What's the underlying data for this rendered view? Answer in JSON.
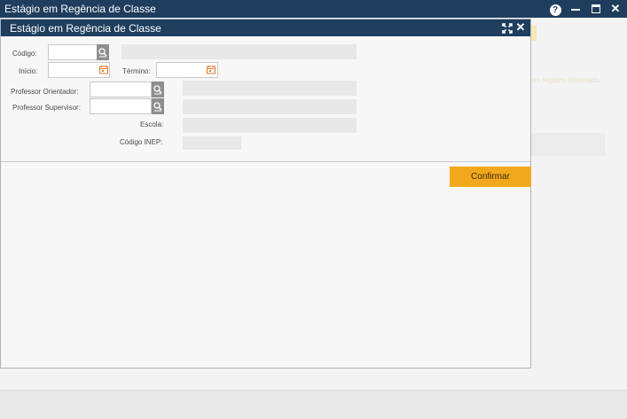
{
  "app": {
    "title": "Estágio em Regência de Classe",
    "help_label": "?",
    "close_label": "✕"
  },
  "background": {
    "hint_text": "um registro informado"
  },
  "dialog": {
    "title": "Estágio em Regência de Classe",
    "close_label": "✕",
    "fields": {
      "codigo_label": "Código:",
      "inicio_label": "Início:",
      "termino_label": "Término:",
      "prof_orientador_label": "Professor Orientador:",
      "prof_supervisor_label": "Professor Supervisor:",
      "escola_label": "Escola:",
      "codigo_inep_label": "Código INEP:"
    },
    "values": {
      "codigo": "",
      "inicio": "",
      "termino": "",
      "prof_orientador": "",
      "prof_supervisor": ""
    },
    "confirm_label": "Confirmar"
  },
  "colors": {
    "titlebar": "#1f3e5e",
    "accent": "#f2a81d"
  },
  "icons": [
    "help-icon",
    "minimize-icon",
    "maximize-icon",
    "close-icon",
    "expand-icon",
    "lookup-icon",
    "calendar-icon"
  ]
}
